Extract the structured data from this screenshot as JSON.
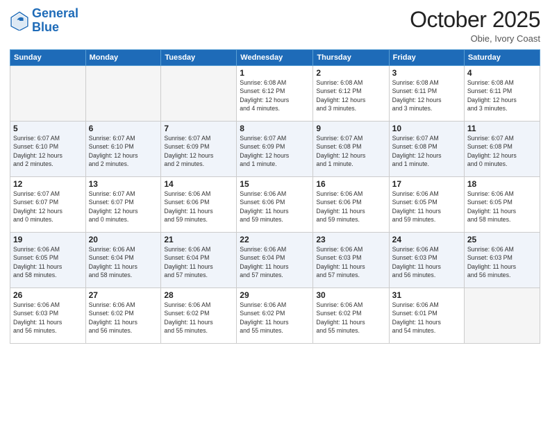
{
  "logo": {
    "text1": "General",
    "text2": "Blue"
  },
  "header": {
    "month": "October 2025",
    "location": "Obie, Ivory Coast"
  },
  "weekdays": [
    "Sunday",
    "Monday",
    "Tuesday",
    "Wednesday",
    "Thursday",
    "Friday",
    "Saturday"
  ],
  "weeks": [
    [
      {
        "day": "",
        "info": ""
      },
      {
        "day": "",
        "info": ""
      },
      {
        "day": "",
        "info": ""
      },
      {
        "day": "1",
        "info": "Sunrise: 6:08 AM\nSunset: 6:12 PM\nDaylight: 12 hours\nand 4 minutes."
      },
      {
        "day": "2",
        "info": "Sunrise: 6:08 AM\nSunset: 6:12 PM\nDaylight: 12 hours\nand 3 minutes."
      },
      {
        "day": "3",
        "info": "Sunrise: 6:08 AM\nSunset: 6:11 PM\nDaylight: 12 hours\nand 3 minutes."
      },
      {
        "day": "4",
        "info": "Sunrise: 6:08 AM\nSunset: 6:11 PM\nDaylight: 12 hours\nand 3 minutes."
      }
    ],
    [
      {
        "day": "5",
        "info": "Sunrise: 6:07 AM\nSunset: 6:10 PM\nDaylight: 12 hours\nand 2 minutes."
      },
      {
        "day": "6",
        "info": "Sunrise: 6:07 AM\nSunset: 6:10 PM\nDaylight: 12 hours\nand 2 minutes."
      },
      {
        "day": "7",
        "info": "Sunrise: 6:07 AM\nSunset: 6:09 PM\nDaylight: 12 hours\nand 2 minutes."
      },
      {
        "day": "8",
        "info": "Sunrise: 6:07 AM\nSunset: 6:09 PM\nDaylight: 12 hours\nand 1 minute."
      },
      {
        "day": "9",
        "info": "Sunrise: 6:07 AM\nSunset: 6:08 PM\nDaylight: 12 hours\nand 1 minute."
      },
      {
        "day": "10",
        "info": "Sunrise: 6:07 AM\nSunset: 6:08 PM\nDaylight: 12 hours\nand 1 minute."
      },
      {
        "day": "11",
        "info": "Sunrise: 6:07 AM\nSunset: 6:08 PM\nDaylight: 12 hours\nand 0 minutes."
      }
    ],
    [
      {
        "day": "12",
        "info": "Sunrise: 6:07 AM\nSunset: 6:07 PM\nDaylight: 12 hours\nand 0 minutes."
      },
      {
        "day": "13",
        "info": "Sunrise: 6:07 AM\nSunset: 6:07 PM\nDaylight: 12 hours\nand 0 minutes."
      },
      {
        "day": "14",
        "info": "Sunrise: 6:06 AM\nSunset: 6:06 PM\nDaylight: 11 hours\nand 59 minutes."
      },
      {
        "day": "15",
        "info": "Sunrise: 6:06 AM\nSunset: 6:06 PM\nDaylight: 11 hours\nand 59 minutes."
      },
      {
        "day": "16",
        "info": "Sunrise: 6:06 AM\nSunset: 6:06 PM\nDaylight: 11 hours\nand 59 minutes."
      },
      {
        "day": "17",
        "info": "Sunrise: 6:06 AM\nSunset: 6:05 PM\nDaylight: 11 hours\nand 59 minutes."
      },
      {
        "day": "18",
        "info": "Sunrise: 6:06 AM\nSunset: 6:05 PM\nDaylight: 11 hours\nand 58 minutes."
      }
    ],
    [
      {
        "day": "19",
        "info": "Sunrise: 6:06 AM\nSunset: 6:05 PM\nDaylight: 11 hours\nand 58 minutes."
      },
      {
        "day": "20",
        "info": "Sunrise: 6:06 AM\nSunset: 6:04 PM\nDaylight: 11 hours\nand 58 minutes."
      },
      {
        "day": "21",
        "info": "Sunrise: 6:06 AM\nSunset: 6:04 PM\nDaylight: 11 hours\nand 57 minutes."
      },
      {
        "day": "22",
        "info": "Sunrise: 6:06 AM\nSunset: 6:04 PM\nDaylight: 11 hours\nand 57 minutes."
      },
      {
        "day": "23",
        "info": "Sunrise: 6:06 AM\nSunset: 6:03 PM\nDaylight: 11 hours\nand 57 minutes."
      },
      {
        "day": "24",
        "info": "Sunrise: 6:06 AM\nSunset: 6:03 PM\nDaylight: 11 hours\nand 56 minutes."
      },
      {
        "day": "25",
        "info": "Sunrise: 6:06 AM\nSunset: 6:03 PM\nDaylight: 11 hours\nand 56 minutes."
      }
    ],
    [
      {
        "day": "26",
        "info": "Sunrise: 6:06 AM\nSunset: 6:03 PM\nDaylight: 11 hours\nand 56 minutes."
      },
      {
        "day": "27",
        "info": "Sunrise: 6:06 AM\nSunset: 6:02 PM\nDaylight: 11 hours\nand 56 minutes."
      },
      {
        "day": "28",
        "info": "Sunrise: 6:06 AM\nSunset: 6:02 PM\nDaylight: 11 hours\nand 55 minutes."
      },
      {
        "day": "29",
        "info": "Sunrise: 6:06 AM\nSunset: 6:02 PM\nDaylight: 11 hours\nand 55 minutes."
      },
      {
        "day": "30",
        "info": "Sunrise: 6:06 AM\nSunset: 6:02 PM\nDaylight: 11 hours\nand 55 minutes."
      },
      {
        "day": "31",
        "info": "Sunrise: 6:06 AM\nSunset: 6:01 PM\nDaylight: 11 hours\nand 54 minutes."
      },
      {
        "day": "",
        "info": ""
      }
    ]
  ]
}
